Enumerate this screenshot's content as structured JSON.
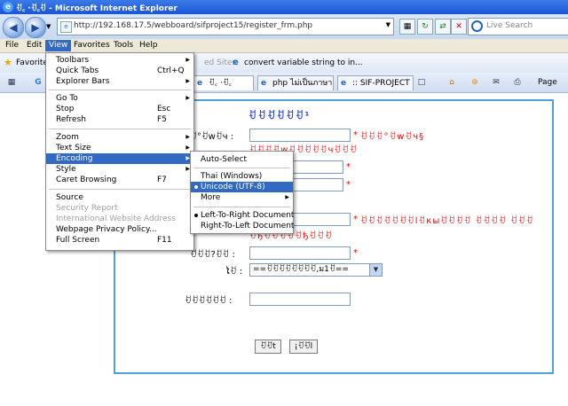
{
  "window": {
    "title": "ꀀ꜀ ·ꀀ꜀ꀀ - Microsoft Internet Explorer"
  },
  "address": {
    "url": "http://192.168.17.5/webboard/sifproject15/register_frm.php"
  },
  "search": {
    "placeholder": "Live Search"
  },
  "menubar": [
    "File",
    "Edit",
    "View",
    "Favorites",
    "Tools",
    "Help"
  ],
  "favbar": {
    "label": "Favorites",
    "suggested": "ed Sites",
    "link": "convert variable  string to in..."
  },
  "tabs": [
    "ꀀ꜀ ·ꀀ꜀",
    "php ไม่เป็นภาษา...",
    ":: SIF-PROJECT ::"
  ],
  "toolbar_right": {
    "page": "Page"
  },
  "view_menu": {
    "items": [
      {
        "label": "Toolbars",
        "key": "",
        "submenu": true
      },
      {
        "label": "Quick Tabs",
        "key": "Ctrl+Q"
      },
      {
        "label": "Explorer Bars",
        "key": "",
        "submenu": true
      },
      {
        "label": "Go To",
        "key": "",
        "submenu": true
      },
      {
        "label": "Stop",
        "key": "Esc"
      },
      {
        "label": "Refresh",
        "key": "F5"
      },
      {
        "label": "Zoom",
        "key": "",
        "submenu": true
      },
      {
        "label": "Text Size",
        "key": "",
        "submenu": true
      },
      {
        "label": "Encoding",
        "key": "",
        "submenu": true
      },
      {
        "label": "Style",
        "key": "",
        "submenu": true
      },
      {
        "label": "Caret Browsing",
        "key": "F7"
      },
      {
        "label": "Source",
        "key": ""
      },
      {
        "label": "Security Report",
        "key": "",
        "disabled": true
      },
      {
        "label": "International Website Address",
        "key": "",
        "disabled": true
      },
      {
        "label": "Webpage Privacy Policy...",
        "key": ""
      },
      {
        "label": "Full Screen",
        "key": "F11"
      }
    ]
  },
  "encoding_menu": {
    "items": [
      {
        "label": "Auto-Select"
      },
      {
        "label": "Thai (Windows)"
      },
      {
        "label": "Unicode (UTF-8)",
        "selected": true
      },
      {
        "label": "More",
        "submenu": true
      },
      {
        "label": "Left-To-Right Document",
        "selected": true
      },
      {
        "label": "Right-To-Left Document"
      }
    ]
  },
  "form": {
    "heading": "ꀀꀀꀀꀀꀀꀀ¹",
    "username_label": "ꀀ°ꀀwꀀч :",
    "username_note": "ꀀꀀꀀ°ꀀwꀀч§",
    "username_note2": "ꀀꀀꀀꀀwꀀꀀꀀꀀꀀчꀀꀀꀀ",
    "email_note": "ꀀꀀꀀꀀꀀꀀꀀlꀀкыꀀꀀꀀꀀ ꀀꀀꀀꀀ ꀀꀀꀀ",
    "email_note2": "ꀀђꀀꀀꀀꀀꀀђꀀꀀꀀ",
    "field5_label": "ꀀꀀꀀ?ꀀꀀ :",
    "province_label": "ໄꀀ :",
    "province_select": "==ꀀꀀꀀꀀꀀꀀꀀꀀ,ม1ꀀ==",
    "field7_label": "ꀀꀀꀀꀀꀀꀀ :",
    "submit": "ꀀꀀt",
    "reset": "¡ꀀꀀl",
    "required": "*"
  }
}
